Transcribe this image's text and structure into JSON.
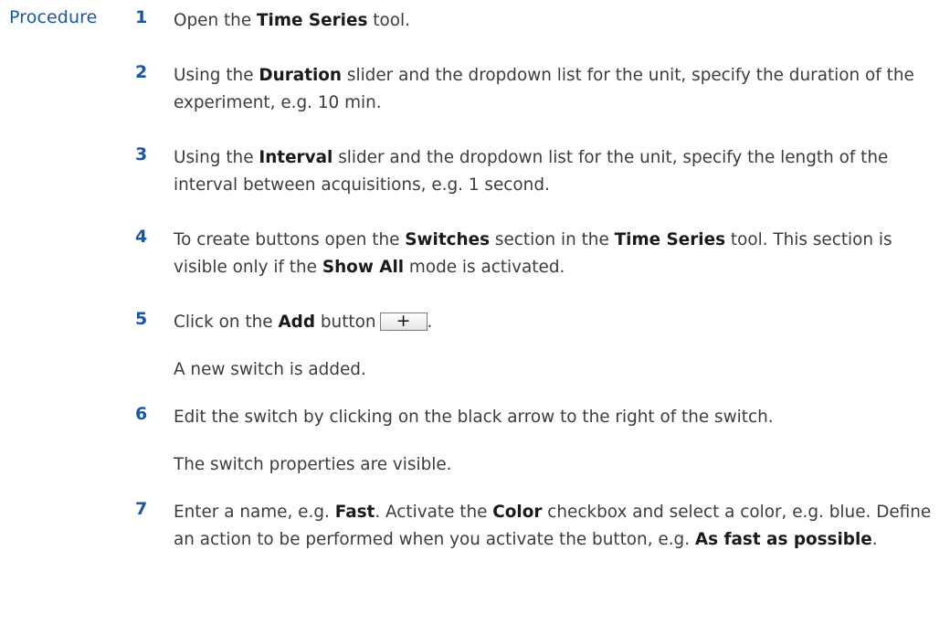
{
  "heading": "Procedure",
  "steps": [
    {
      "num": "1",
      "t1": "Open the ",
      "b1": "Time Series",
      "t2": " tool."
    },
    {
      "num": "2",
      "t1": "Using the ",
      "b1": "Duration",
      "t2": " slider and the dropdown list for the unit, specify the duration of the experiment, e.g. 10 min."
    },
    {
      "num": "3",
      "t1": "Using the ",
      "b1": "Interval",
      "t2": " slider and the dropdown list for the unit, specify the length of the interval between acquisitions, e.g. 1 second."
    },
    {
      "num": "4",
      "t1": "To create buttons open the ",
      "b1": "Switches",
      "t2": " section in the ",
      "b2": "Time Series",
      "t3": " tool. This section is visible only if the ",
      "b3": "Show All",
      "t4": " mode is activated."
    },
    {
      "num": "5",
      "t1": "Click on the ",
      "b1": "Add",
      "t2": " button",
      "button_glyph": "+",
      "t3": ".",
      "result": "A new switch is added."
    },
    {
      "num": "6",
      "t1": "Edit the switch by clicking on the black arrow to the right of the switch.",
      "result": "The switch properties are visible."
    },
    {
      "num": "7",
      "t1": "Enter a name, e.g. ",
      "b1": "Fast",
      "t2": ". Activate the ",
      "b2": "Color",
      "t3": " checkbox and select a color, e.g. blue. Define an action to be performed when you activate the button, e.g. ",
      "b3": "As fast as possible",
      "t4": "."
    }
  ]
}
